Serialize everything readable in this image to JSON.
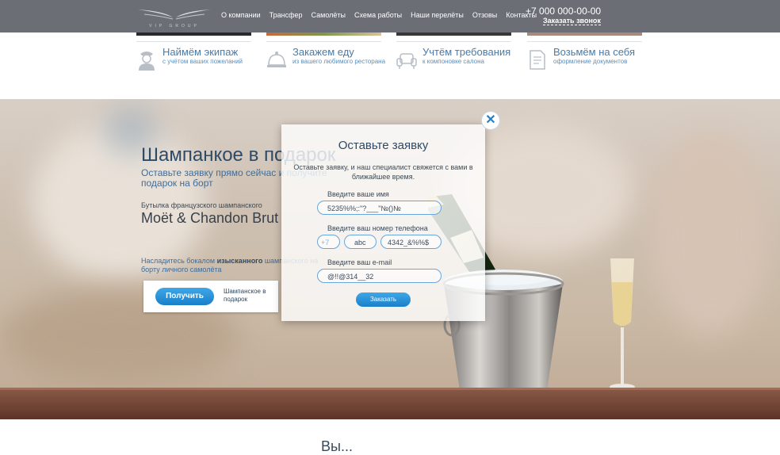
{
  "header": {
    "logo_text": "VIP GROUP",
    "nav": [
      "О компании",
      "Трансфер",
      "Самолёты",
      "Схема работы",
      "Наши перелёты",
      "Отзовы",
      "Контакты"
    ],
    "phone": "+7 000 000-00-00",
    "callback": "Заказать звонок"
  },
  "features": [
    {
      "title": "Наймём экипаж",
      "desc": "с учётом ваших пожеланий",
      "icon": "pilot-icon"
    },
    {
      "title": "Закажем еду",
      "desc": "из вашего любимого ресторана",
      "icon": "food-cloche-icon"
    },
    {
      "title": "Учтём требования",
      "desc": "к компоновке салона",
      "icon": "armchair-icon"
    },
    {
      "title": "Возьмём на себя",
      "desc": "оформление документов",
      "icon": "documents-icon"
    }
  ],
  "promo": {
    "title": "Шампанкое в подарок",
    "subtitle": "Оставьте заявку прямо сейчас и получите подарок на борт",
    "bottle_label": "Бутылка французского шампанского",
    "brand": "Moët & Chandon Brut",
    "text_before": "Насладитесь бокалом ",
    "text_bold": "изысканного",
    "text_after": " шампанского на борту личного самолёта",
    "get_button": "Получить",
    "get_label": "Шампанское в подарок"
  },
  "modal": {
    "title": "Оставьте заявку",
    "description": "Оставьте заявку, и наш специалист свяжется с вами в ближайшее время.",
    "name_label": "Введите ваше имя",
    "name_value": "5235%%;:\"?___\"№()№",
    "phone_label": "Введите ваш номер телефона",
    "phone_code": "+7",
    "phone_prefix": "abc",
    "phone_number": "4342_&%%$",
    "email_label": "Введите ваш e-mail",
    "email_value": "@!!@314__32",
    "submit": "Заказать",
    "close": "✕"
  },
  "next_section": {
    "heading": "Вы..."
  },
  "colors": {
    "header_bg": "#6b6e75",
    "accent_blue": "#1a7fc9",
    "title_blue": "#2e4a66"
  }
}
